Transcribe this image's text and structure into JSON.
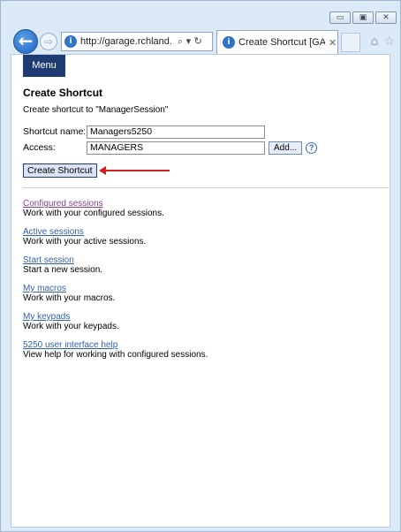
{
  "browser": {
    "window_controls": {
      "minimize": "▭",
      "maximize": "▣",
      "close": "✕"
    },
    "back_icon": "←",
    "forward_icon": "⇨",
    "address": "http://garage.rchland.",
    "address_icons": "⌕ ▾ ↻",
    "tab_title": "Create Shortcut [GAR...",
    "tab_close": "✕",
    "nav_icons": [
      "⌂",
      "☆"
    ]
  },
  "page": {
    "menu_label": "Menu",
    "title": "Create Shortcut",
    "subtitle": "Create shortcut to \"ManagerSession\"",
    "form": {
      "shortcut_name_label": "Shortcut name:",
      "shortcut_name_value": "Managers5250",
      "access_label": "Access:",
      "access_value": "MANAGERS",
      "add_label": "Add...",
      "help_icon": "?"
    },
    "create_button_label": "Create Shortcut",
    "links": [
      {
        "label": "Configured sessions",
        "desc": "Work with your configured sessions."
      },
      {
        "label": "Active sessions",
        "desc": "Work with your active sessions."
      },
      {
        "label": "Start session",
        "desc": "Start a new session."
      },
      {
        "label": "My macros",
        "desc": "Work with your macros."
      },
      {
        "label": "My keypads",
        "desc": "Work with your keypads."
      },
      {
        "label": "5250 user interface help",
        "desc": "View help for working with configured sessions."
      }
    ]
  }
}
